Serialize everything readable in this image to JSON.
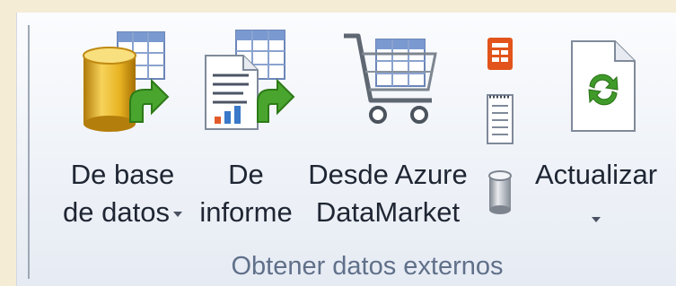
{
  "group": {
    "title": "Obtener datos externos"
  },
  "buttons": {
    "database": {
      "line1": "De base",
      "line2": "de datos",
      "icon": "database-table-icon"
    },
    "report": {
      "line1": "De",
      "line2": "informe",
      "icon": "report-icon"
    },
    "azure": {
      "line1": "Desde Azure",
      "line2": "DataMarket",
      "icon": "shopping-cart-icon"
    },
    "refresh": {
      "line1": "Actualizar",
      "icon": "refresh-document-icon"
    }
  },
  "small_icons": [
    "office-app-icon",
    "text-file-icon",
    "database-cylinder-icon"
  ],
  "colors": {
    "accent_green": "#3f9a2a",
    "cylinder_gold": "#e1a71c",
    "office_orange": "#e2541b"
  }
}
